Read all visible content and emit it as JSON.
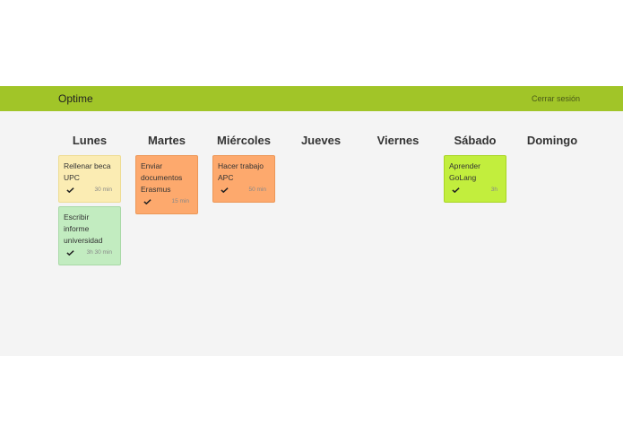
{
  "header": {
    "brand": "Optime",
    "logout_label": "Cerrar sesión"
  },
  "days": [
    {
      "name": "Lunes",
      "tasks": [
        {
          "title": "Rellenar beca UPC",
          "duration": "30 min",
          "color": "#fbecb3",
          "border": "#eedc92"
        },
        {
          "title": "Escribir informe universidad",
          "duration": "3h 30 min",
          "color": "#c2ecc0",
          "border": "#a8d9a6"
        }
      ]
    },
    {
      "name": "Martes",
      "tasks": [
        {
          "title": "Enviar documentos Erasmus",
          "duration": "15 min",
          "color": "#fda96d",
          "border": "#ec9757"
        }
      ]
    },
    {
      "name": "Miércoles",
      "tasks": [
        {
          "title": "Hacer trabajo APC",
          "duration": "50 min",
          "color": "#fda96d",
          "border": "#ec9757"
        }
      ]
    },
    {
      "name": "Jueves",
      "tasks": []
    },
    {
      "name": "Viernes",
      "tasks": []
    },
    {
      "name": "Sábado",
      "tasks": [
        {
          "title": "Aprender GoLang",
          "duration": "3h",
          "color": "#c2ee3d",
          "border": "#a9d524"
        }
      ]
    },
    {
      "name": "Domingo",
      "tasks": []
    }
  ]
}
